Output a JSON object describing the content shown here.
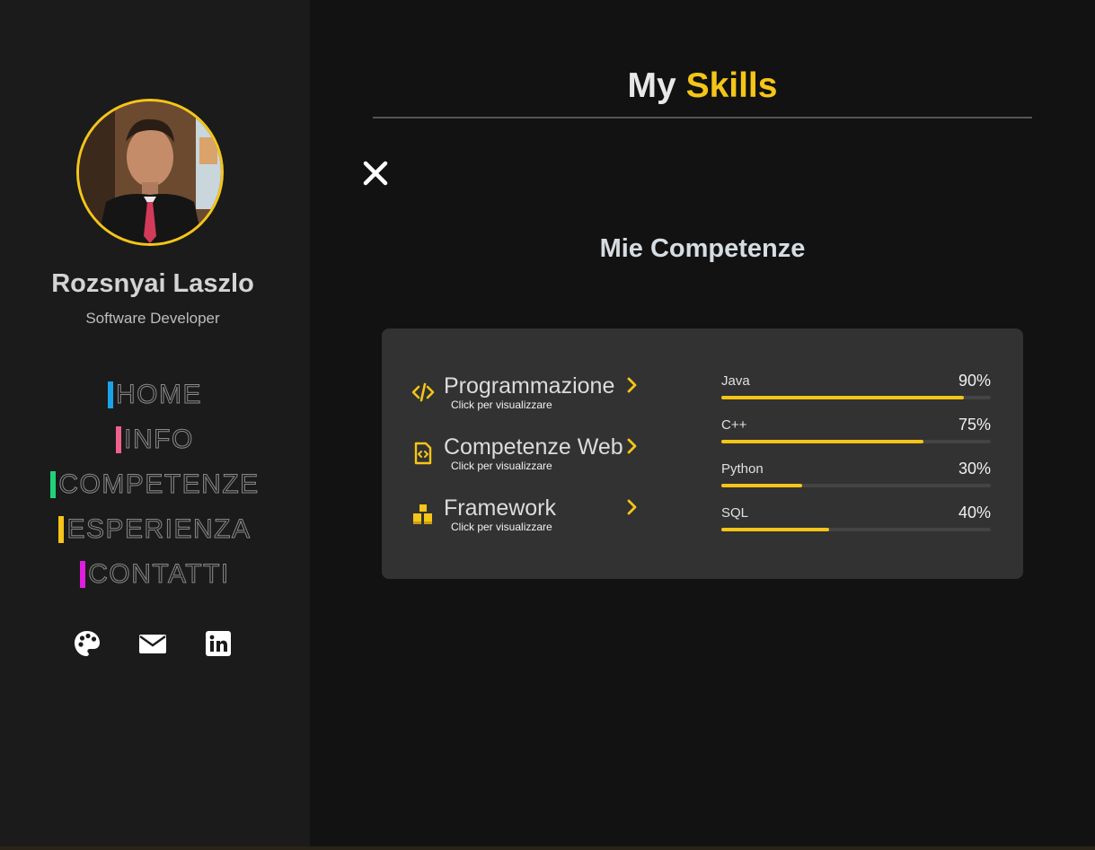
{
  "profile": {
    "name": "Rozsnyai Laszlo",
    "role": "Software Developer"
  },
  "nav": {
    "items": [
      {
        "label": "HOME",
        "color": "#1aa3e8"
      },
      {
        "label": "INFO",
        "color": "#f0608a"
      },
      {
        "label": "COMPETENZE",
        "color": "#1fd27a"
      },
      {
        "label": "ESPERIENZA",
        "color": "#f5c518"
      },
      {
        "label": "CONTATTI",
        "color": "#e01ee0"
      }
    ]
  },
  "social": [
    "palette-icon",
    "envelope-icon",
    "linkedin-icon"
  ],
  "header": {
    "title_plain": "My",
    "title_accent": "Skills"
  },
  "section": {
    "subtitle": "Mie Competenze"
  },
  "categories": [
    {
      "title": "Programmazione",
      "hint": "Click per visualizzare",
      "icon": "code-icon"
    },
    {
      "title": "Competenze Web",
      "hint": "Click per visualizzare",
      "icon": "code-file-icon"
    },
    {
      "title": "Framework",
      "hint": "Click per visualizzare",
      "icon": "cubes-icon"
    }
  ],
  "skills": [
    {
      "name": "Java",
      "percent_label": "90%",
      "level": 0.9
    },
    {
      "name": "C++",
      "percent_label": "75%",
      "level": 0.75
    },
    {
      "name": "Python",
      "percent_label": "30%",
      "level": 0.3
    },
    {
      "name": "SQL",
      "percent_label": "40%",
      "level": 0.4
    }
  ],
  "colors": {
    "accent": "#f5c518",
    "sidebar_bg": "#1b1b1b",
    "page_bg": "#121212",
    "card_bg": "#323232"
  }
}
